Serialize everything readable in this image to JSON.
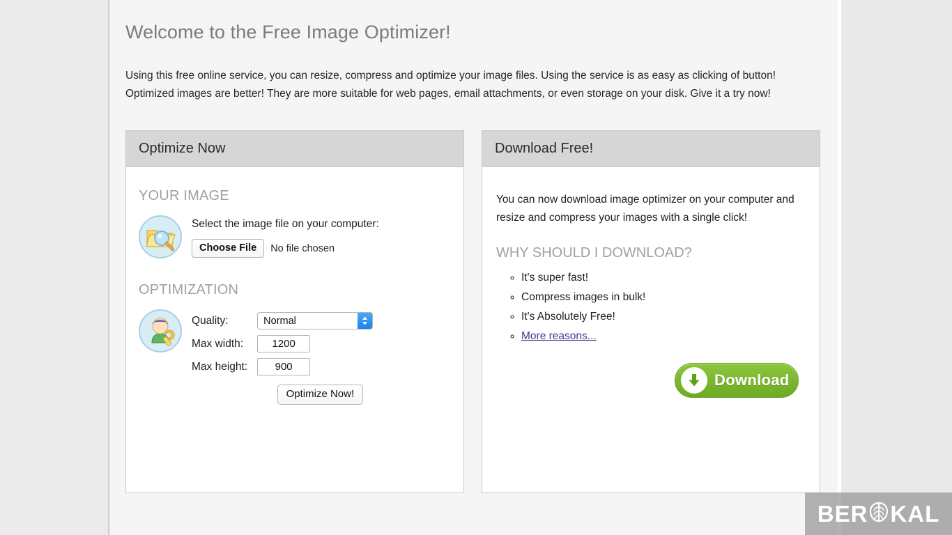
{
  "page": {
    "title": "Welcome to the Free Image Optimizer!",
    "intro": "Using this free online service, you can resize, compress and optimize your image files. Using the service is as easy as clicking of button! Optimized images are better! They are more suitable for web pages, email attachments, or even storage on your disk. Give it a try now!"
  },
  "optimize_panel": {
    "header": "Optimize Now",
    "your_image": {
      "section_title": "YOUR IMAGE",
      "icon": "folder-search-icon",
      "prompt": "Select the image file on your computer:",
      "choose_file_label": "Choose File",
      "file_status": "No file chosen"
    },
    "optimization": {
      "section_title": "OPTIMIZATION",
      "icon": "worker-wrench-icon",
      "quality_label": "Quality:",
      "quality_value": "Normal",
      "quality_options": [
        "Normal"
      ],
      "max_width_label": "Max width:",
      "max_width_value": "1200",
      "max_height_label": "Max height:",
      "max_height_value": "900",
      "submit_label": "Optimize Now!"
    }
  },
  "download_panel": {
    "header": "Download Free!",
    "body_text": "You can now download image optimizer on your computer and resize and compress your images with a single click!",
    "why_title": "WHY SHOULD I DOWNLOAD?",
    "reasons": [
      "It's super fast!",
      "Compress images in bulk!",
      "It's Absolutely Free!"
    ],
    "more_reasons_link": "More reasons...",
    "download_button_label": "Download",
    "download_icon": "download-arrow-icon"
  },
  "watermark": {
    "text_before": "BER",
    "logo": "brain-icon",
    "text_after": "KAL"
  },
  "colors": {
    "accent_green": "#7cb82f",
    "link": "#3b3b8f",
    "panel_header_bg": "#d6d6d6",
    "heading_gray": "#7b7b7b",
    "select_button_blue": "#1a82ec"
  }
}
